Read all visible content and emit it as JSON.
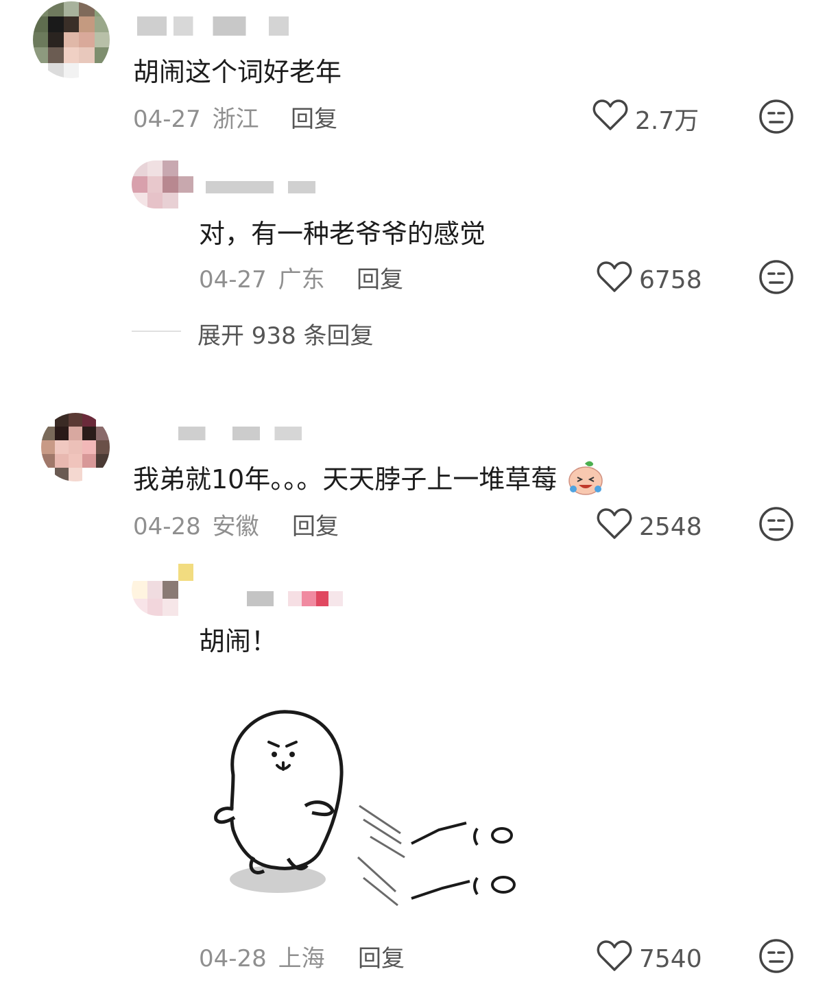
{
  "comments": [
    {
      "text": "胡闹这个词好老年",
      "date": "04-27",
      "location": "浙江",
      "reply_label": "回复",
      "likes": "2.7万",
      "replies": [
        {
          "text": "对，有一种老爷爷的感觉",
          "date": "04-27",
          "location": "广东",
          "reply_label": "回复",
          "likes": "6758"
        }
      ],
      "expand_label": "展开 938 条回复"
    },
    {
      "text": "我弟就10年。。。天天脖子上一堆草莓",
      "date": "04-28",
      "location": "安徽",
      "reply_label": "回复",
      "likes": "2548",
      "replies": [
        {
          "text": "胡闹！",
          "sticker": "seal-sticker",
          "date": "04-28",
          "location": "上海",
          "reply_label": "回复",
          "likes": "7540"
        }
      ]
    }
  ],
  "icons": {
    "like": "heart-outline-icon",
    "dislike": "meh-face-icon",
    "emoji": "laughing-crying-emoji"
  },
  "colors": {
    "text": "#1c1c1c",
    "meta": "#8f8f8f",
    "icon": "#555555"
  }
}
